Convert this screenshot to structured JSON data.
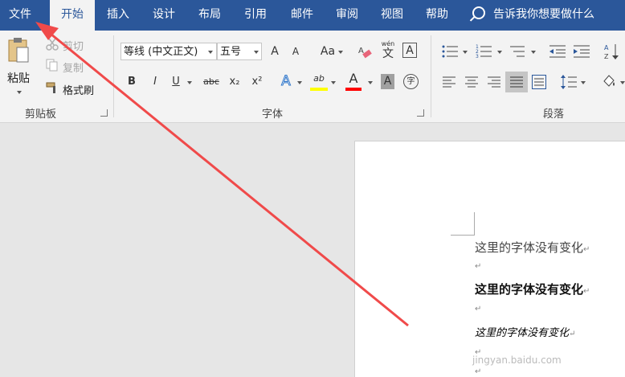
{
  "menu": {
    "tabs": [
      "文件",
      "开始",
      "插入",
      "设计",
      "布局",
      "引用",
      "邮件",
      "审阅",
      "视图",
      "帮助"
    ],
    "active_index": 1,
    "tell_me": "告诉我你想要做什么"
  },
  "clipboard": {
    "paste": "粘贴",
    "cut": "剪切",
    "copy": "复制",
    "format_painter": "格式刷",
    "group_label": "剪贴板"
  },
  "font": {
    "font_name": "等线 (中文正文)",
    "font_size": "五号",
    "grow": "A",
    "shrink": "A",
    "change_case": "Aa",
    "pinyin_top": "wén",
    "pinyin_char": "文",
    "border_char": "A",
    "bold": "B",
    "italic": "I",
    "underline": "U",
    "strike": "abc",
    "subscript": "x₂",
    "superscript": "x²",
    "effects": "A",
    "highlight": "ab",
    "font_color": "A",
    "shade": "A",
    "enclose": "字",
    "group_label": "字体"
  },
  "paragraph": {
    "group_label": "段落"
  },
  "document": {
    "lines": [
      "这里的字体没有变化",
      "这里的字体没有变化",
      "这里的字体没有变化"
    ],
    "para_mark": "↵"
  },
  "watermark": "jingyan.baidu.com",
  "colors": {
    "brand": "#2b579a",
    "annotation_arrow": "#f04a4a",
    "highlight_yellow": "#ffff00",
    "font_red": "#ff0000"
  }
}
